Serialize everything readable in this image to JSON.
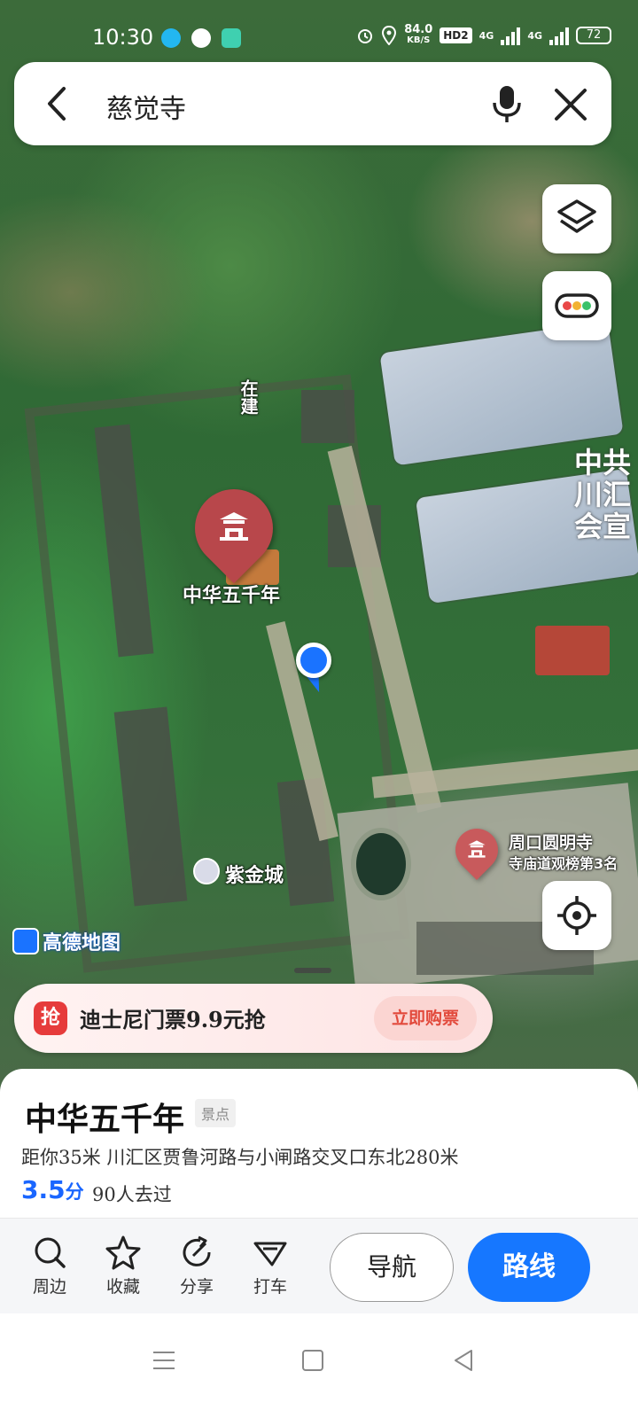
{
  "status_bar": {
    "time": "10:30",
    "speed_value": "84.0",
    "speed_unit": "KB/S",
    "hd_label": "HD2",
    "net1": "4G",
    "net2": "4G",
    "battery": "72"
  },
  "search": {
    "query": "慈觉寺"
  },
  "map": {
    "label_under_construction": "在建",
    "pin_main_label": "中华五千年",
    "poi_secondary_name": "周口圆明寺",
    "poi_secondary_desc": "寺庙道观榜第3名",
    "poi_small_label": "紫金城",
    "edge_label_line1": "中共",
    "edge_label_line2": "川汇",
    "edge_label_line3": "会宣",
    "brand_logo": "高德地图"
  },
  "promo": {
    "badge": "抢",
    "text": "迪士尼门票9.9元抢",
    "button": "立即购票"
  },
  "place": {
    "name": "中华五千年",
    "category": "景点",
    "address": "距你35米  川汇区贾鲁河路与小闸路交叉口东北280米",
    "score": "3.5",
    "score_unit": "分",
    "visited": "90人去过"
  },
  "actions": {
    "nearby": "周边",
    "favorite": "收藏",
    "share": "分享",
    "taxi": "打车",
    "navigate": "导航",
    "route": "路线"
  },
  "colors": {
    "accent": "#1677ff",
    "pin": "#b8474b",
    "promo_red": "#e63b3b"
  },
  "icons": [
    "back-arrow-icon",
    "microphone-icon",
    "close-icon",
    "layers-icon",
    "traffic-icon",
    "locate-icon",
    "search-icon",
    "star-icon",
    "share-icon",
    "taxi-icon",
    "menu-icon",
    "home-square-icon",
    "back-triangle-icon"
  ]
}
